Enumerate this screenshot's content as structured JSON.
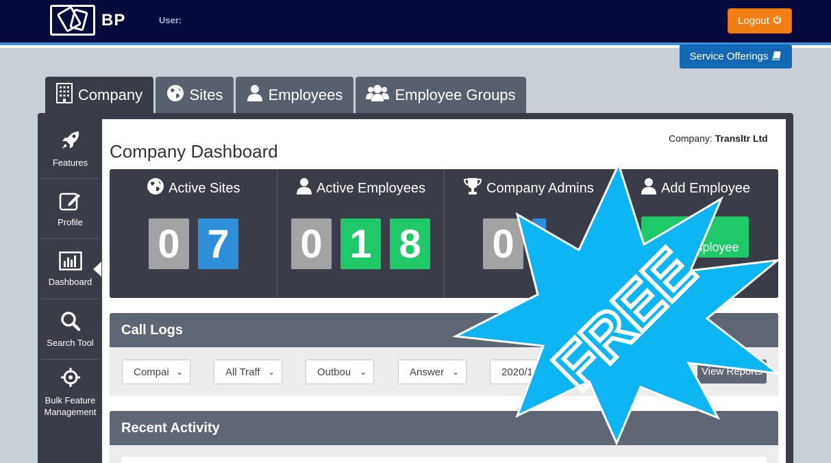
{
  "header": {
    "logo_text": "BP",
    "user_label": "User:",
    "logout_label": "Logout",
    "service_offerings_label": "Service Offerings"
  },
  "tabs": [
    {
      "label": "Company",
      "icon": "building-icon",
      "active": true
    },
    {
      "label": "Sites",
      "icon": "globe-icon"
    },
    {
      "label": "Employees",
      "icon": "user-icon"
    },
    {
      "label": "Employee Groups",
      "icon": "users-icon"
    }
  ],
  "sidebar": {
    "items": [
      {
        "label": "Features",
        "icon": "rocket-icon"
      },
      {
        "label": "Profile",
        "icon": "edit-icon"
      },
      {
        "label": "Dashboard",
        "icon": "bar-chart-icon",
        "active": true
      },
      {
        "label": "Search Tool",
        "icon": "search-icon"
      },
      {
        "label": "Bulk Feature Management",
        "icon": "crosshair-icon"
      }
    ]
  },
  "main": {
    "company_label": "Company:",
    "company_name": "Transltr Ltd",
    "title": "Company Dashboard",
    "stats": {
      "active_sites": {
        "label": "Active Sites",
        "digits": [
          "0",
          "7"
        ]
      },
      "active_employees": {
        "label": "Active Employees",
        "digits": [
          "0",
          "1",
          "8"
        ]
      },
      "company_admins": {
        "label": "Company Admins",
        "digits": [
          "0"
        ]
      },
      "add_employee": {
        "label": "Add Employee",
        "button_text": "mployee"
      }
    },
    "call_logs": {
      "title": "Call Logs",
      "filters": [
        "Compai",
        "All Traff",
        "Outbou",
        "Answer",
        "2020/1"
      ],
      "view_reports_label": "View Reports"
    },
    "recent_activity": {
      "title": "Recent Activity"
    }
  },
  "overlay": {
    "text": "FREE",
    "color": "#0db6f2"
  }
}
